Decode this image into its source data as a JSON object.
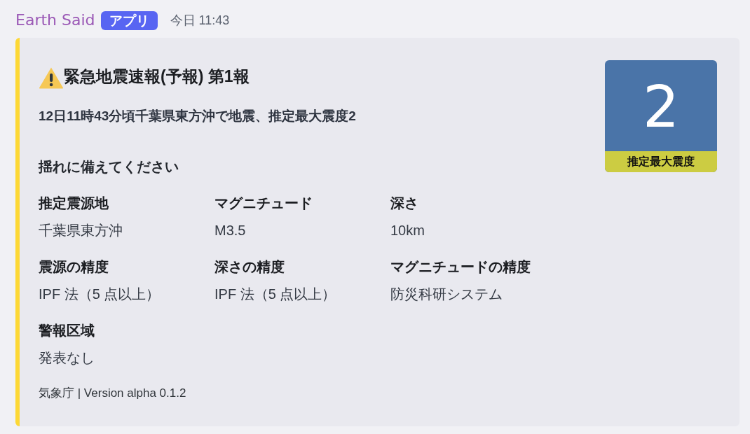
{
  "message": {
    "author": "Earth Said",
    "badge": "アプリ",
    "timestamp": "今日 11:43"
  },
  "embed": {
    "title": "緊急地震速報(予報) 第1報",
    "description": "12日11時43分頃千葉県東方沖で地震、推定最大震度2",
    "notice": "揺れに備えてください",
    "field_rows": [
      [
        {
          "name": "推定震源地",
          "value": "千葉県東方沖"
        },
        {
          "name": "マグニチュード",
          "value": "M3.5"
        },
        {
          "name": "深さ",
          "value": "10km"
        }
      ],
      [
        {
          "name": "震源の精度",
          "value": "IPF 法（5 点以上）"
        },
        {
          "name": "深さの精度",
          "value": "IPF 法（5 点以上）"
        },
        {
          "name": "マグニチュードの精度",
          "value": "防災科研システム"
        }
      ],
      [
        {
          "name": "警報区域",
          "value": "発表なし"
        }
      ]
    ],
    "thumbnail": {
      "intensity": "2",
      "caption": "推定最大震度"
    },
    "footer": "気象庁 | Version alpha 0.1.2"
  }
}
